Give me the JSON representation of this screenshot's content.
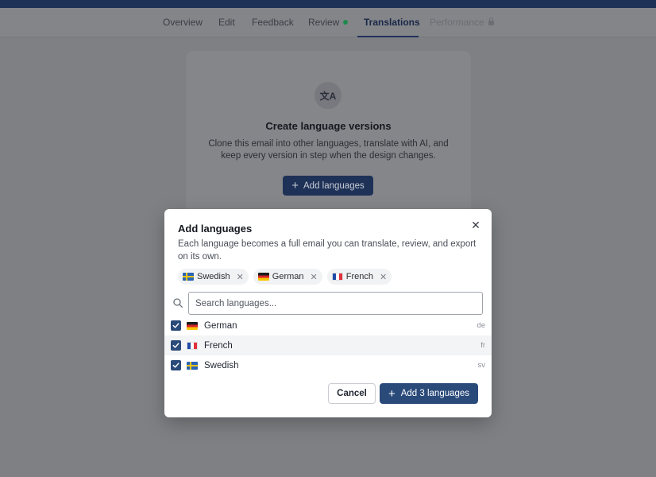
{
  "background": {
    "tabs": [
      {
        "label": "Overview"
      },
      {
        "label": "Edit"
      },
      {
        "label": "Feedback"
      },
      {
        "label": "Review"
      },
      {
        "label": "Translations"
      },
      {
        "label": "Performance"
      }
    ],
    "card": {
      "icon_glyph": "文A",
      "title": "Create language versions",
      "description": "Clone this email into other languages, translate with AI, and keep every version in step when the design changes.",
      "button_label": "Add languages"
    }
  },
  "modal": {
    "title": "Add languages",
    "description": "Each language becomes a full email you can translate, review, and export on its own.",
    "close_glyph": "✕",
    "chips": [
      {
        "label": "Swedish",
        "flag": "se"
      },
      {
        "label": "German",
        "flag": "de"
      },
      {
        "label": "French",
        "flag": "fr"
      }
    ],
    "chip_remove_glyph": "✕",
    "search": {
      "placeholder": "Search languages...",
      "value": ""
    },
    "languages": [
      {
        "name": "German",
        "code": "de",
        "flag": "de",
        "checked": true
      },
      {
        "name": "French",
        "code": "fr",
        "flag": "fr",
        "checked": true
      },
      {
        "name": "Swedish",
        "code": "sv",
        "flag": "se",
        "checked": true
      }
    ],
    "cancel_label": "Cancel",
    "confirm_label": "Add 3 languages"
  },
  "colors": {
    "brand": "#1e3157",
    "primary_button": "#2a4a7a",
    "review_dot": "#1f8a4d"
  }
}
